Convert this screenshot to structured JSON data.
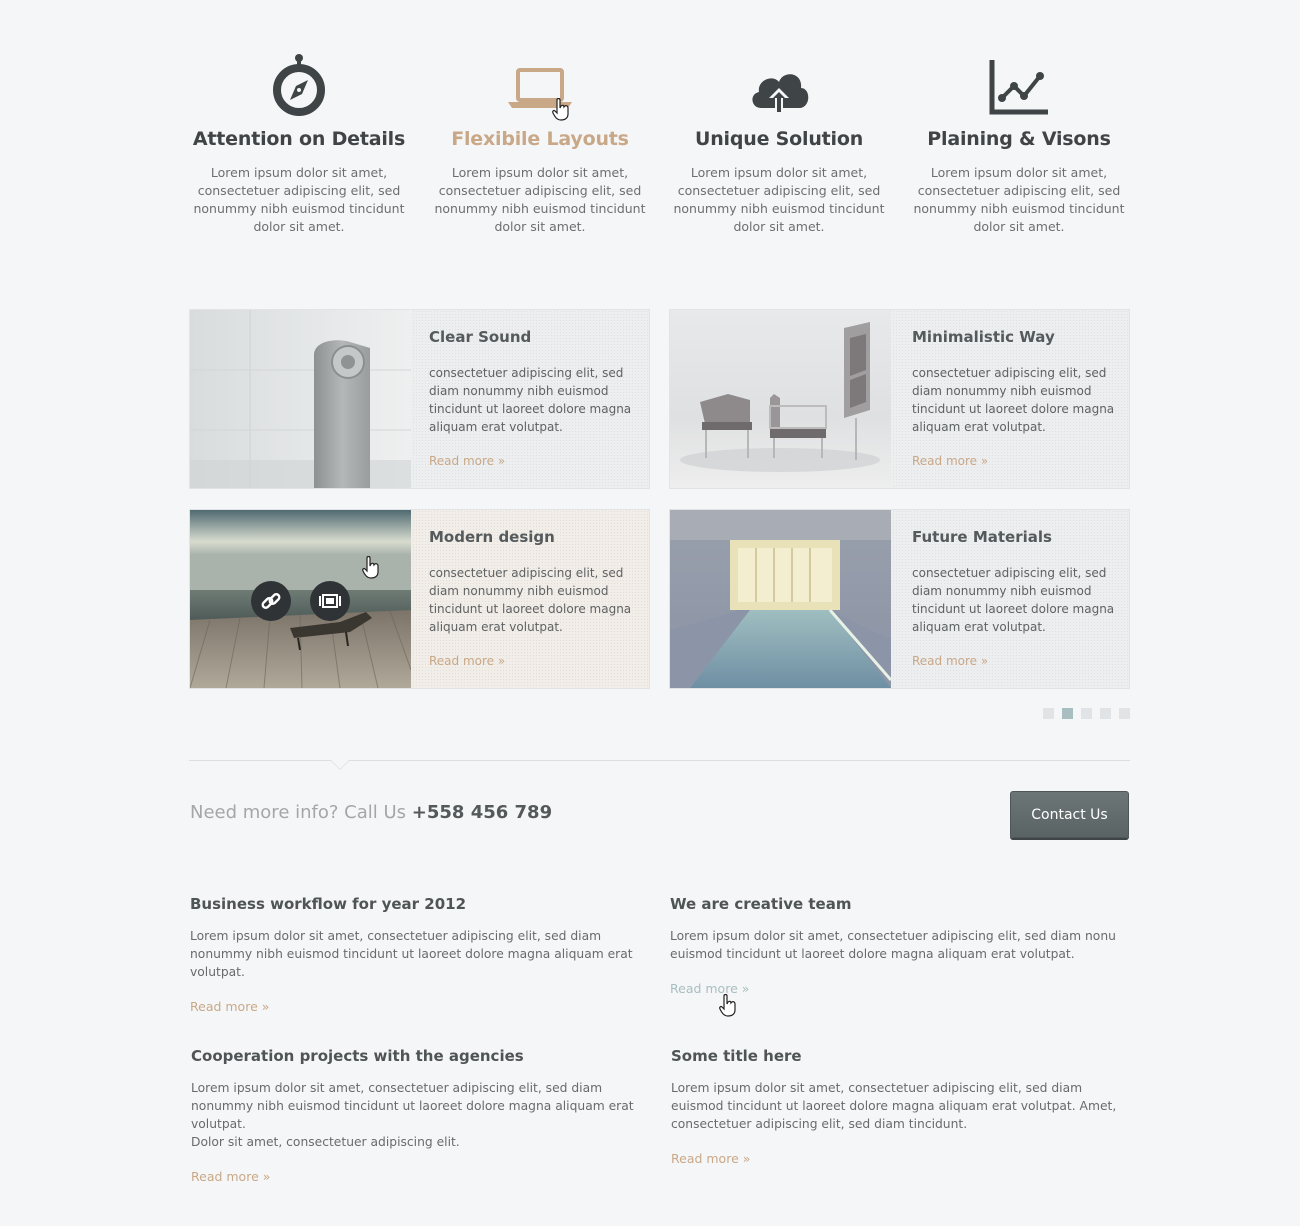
{
  "features": [
    {
      "icon": "compass-icon",
      "title": "Attention on Details",
      "text": "Lorem ipsum dolor sit amet, consectetuer adipiscing elit, sed nonummy nibh euismod tincidunt dolor sit amet."
    },
    {
      "icon": "laptop-icon",
      "title": "Flexibile Layouts",
      "text": "Lorem ipsum dolor sit amet, consectetuer adipiscing elit, sed nonummy nibh euismod tincidunt dolor sit amet."
    },
    {
      "icon": "cloud-upload-icon",
      "title": "Unique Solution",
      "text": "Lorem ipsum dolor sit amet, consectetuer adipiscing elit, sed nonummy nibh euismod tincidunt dolor sit amet."
    },
    {
      "icon": "line-chart-icon",
      "title": "Plaining & Visons",
      "text": "Lorem ipsum dolor sit amet, consectetuer adipiscing elit, sed nonummy nibh euismod tincidunt dolor sit amet."
    }
  ],
  "cards": [
    {
      "title": "Clear Sound",
      "text": "consectetuer adipiscing elit, sed diam nonummy nibh euismod tincidunt ut laoreet dolore magna aliquam erat volutpat.",
      "link": "Read more »"
    },
    {
      "title": "Minimalistic Way",
      "text": "consectetuer adipiscing elit, sed diam nonummy nibh euismod tincidunt ut laoreet dolore magna aliquam erat volutpat.",
      "link": "Read more »"
    },
    {
      "title": "Modern design",
      "text": "consectetuer adipiscing elit, sed diam nonummy nibh euismod tincidunt ut laoreet dolore magna aliquam erat volutpat.",
      "link": "Read more »"
    },
    {
      "title": "Future Materials",
      "text": "consectetuer adipiscing elit, sed diam nonummy nibh euismod tincidunt ut laoreet dolore magna aliquam erat volutpat.",
      "link": "Read more »"
    }
  ],
  "pagination": {
    "count": 5,
    "active": 2
  },
  "cta": {
    "text": "Need more info? Call Us",
    "phone": "+558 456 789",
    "button": "Contact Us"
  },
  "posts": [
    {
      "title": "Business workflow for year 2012",
      "text": "Lorem ipsum dolor sit amet, consectetuer adipiscing elit, sed diam nonummy nibh euismod tincidunt ut laoreet dolore magna aliquam erat volutpat.",
      "link": "Read more »"
    },
    {
      "title": "We are creative team",
      "text": "Lorem ipsum dolor sit amet, consectetuer adipiscing elit, sed diam nonu euismod tincidunt ut laoreet dolore magna aliquam erat volutpat.",
      "link": "Read more »"
    },
    {
      "title": "Cooperation projects with the agencies",
      "text": "Lorem ipsum dolor sit amet, consectetuer adipiscing elit, sed diam nonummy nibh euismod tincidunt ut laoreet dolore magna aliquam erat volutpat.",
      "text2": "Dolor sit amet, consectetuer adipiscing elit.",
      "link": "Read more »"
    },
    {
      "title": "Some title here",
      "text": "Lorem ipsum dolor sit amet, consectetuer adipiscing elit, sed diam euismod tincidunt ut laoreet dolore magna aliquam erat volutpat. Amet, consectetuer adipiscing elit, sed diam tincidunt.",
      "link": "Read more »"
    }
  ],
  "colors": {
    "accent": "#c9a887",
    "hover_link": "#a8bec1",
    "heading": "#404446",
    "button": "#5f696a"
  }
}
